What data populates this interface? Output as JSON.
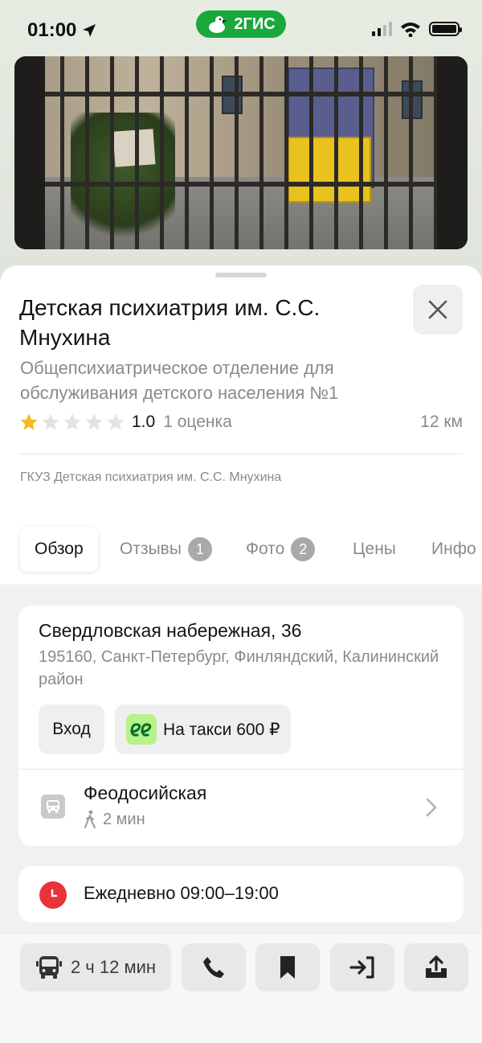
{
  "status_bar": {
    "time": "01:00",
    "app_logo_text": "2ГИС",
    "location_arrow_icon": "location-arrow-icon",
    "signal_icon": "cellular-signal-icon",
    "wifi_icon": "wifi-icon",
    "battery_icon": "battery-icon"
  },
  "place": {
    "title": "Детская психиатрия им. С.С. Мнухина",
    "subtitle": "Общепсихиатрическое отделение для обслуживания детского населения №1",
    "rating_value": "1.0",
    "rating_stars_filled": 1,
    "rating_stars_total": 5,
    "rating_count": "1 оценка",
    "distance": "12 км",
    "organization": "ГКУЗ Детская психиатрия им. С.С. Мнухина"
  },
  "tabs": [
    {
      "label": "Обзор",
      "badge": "",
      "active": true
    },
    {
      "label": "Отзывы",
      "badge": "1",
      "active": false
    },
    {
      "label": "Фото",
      "badge": "2",
      "active": false
    },
    {
      "label": "Цены",
      "badge": "",
      "active": false
    },
    {
      "label": "Инфо",
      "badge": "",
      "active": false
    }
  ],
  "address": {
    "street": "Свердловская набережная, 36",
    "details": "195160, Санкт-Петербург, Финляндский, Калининский район",
    "entrance_label": "Вход",
    "taxi_label": "На такси 600 ₽"
  },
  "transit": {
    "stop_name": "Феодосийская",
    "walk_time": "2 мин"
  },
  "hours": {
    "text": "Ежедневно 09:00–19:00"
  },
  "toolbar": {
    "route_label": "2 ч 12 мин"
  },
  "colors": {
    "brand_green": "#19a83c",
    "star_filled": "#f5b91f",
    "star_empty": "#e3e3e3",
    "hours_icon_red": "#e8333a",
    "taxi_green": "#b8f28a"
  }
}
